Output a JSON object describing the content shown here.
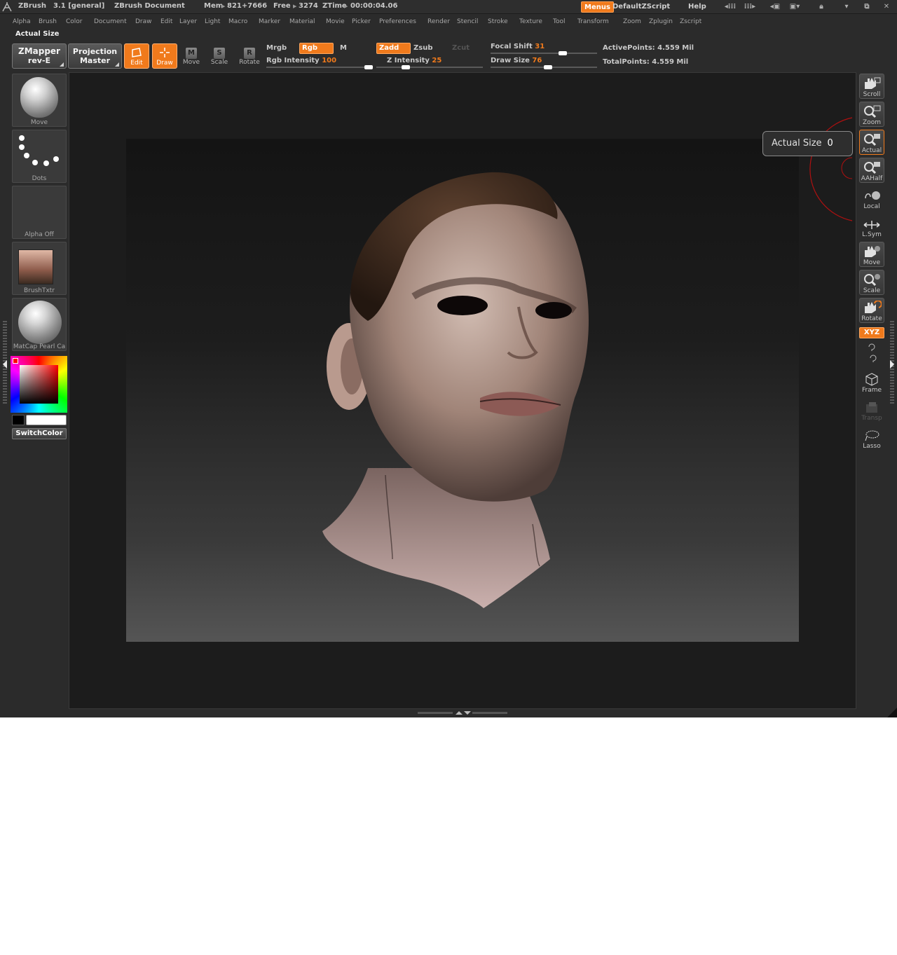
{
  "app": {
    "name": "ZBrush",
    "version": "3.1 [general]",
    "document": "ZBrush Document",
    "mem_label": "Mem",
    "mem_value": "821+7666",
    "free_label": "Free",
    "free_value": "3274",
    "ztime_label": "ZTime",
    "ztime_value": "00:00:04.06"
  },
  "titlebar_buttons": {
    "menus": "Menus",
    "script": "DefaultZScript",
    "help": "Help"
  },
  "menus": [
    "Alpha",
    "Brush",
    "Color",
    "Document",
    "Draw",
    "Edit",
    "Layer",
    "Light",
    "Macro",
    "Marker",
    "Material",
    "Movie",
    "Picker",
    "Preferences",
    "Render",
    "Stencil",
    "Stroke",
    "Texture",
    "Tool",
    "Transform",
    "Zoom",
    "Zplugin",
    "Zscript"
  ],
  "active_item_label": "Actual Size",
  "toolbar": {
    "zmapper_line1": "ZMapper",
    "zmapper_line2": "rev-E",
    "projection_line1": "Projection",
    "projection_line2": "Master",
    "edit": "Edit",
    "draw": "Draw",
    "move": "Move",
    "scale": "Scale",
    "rotate": "Rotate",
    "move_glyph": "M",
    "scale_glyph": "S",
    "rotate_glyph": "R",
    "mrgb": "Mrgb",
    "rgb": "Rgb",
    "m": "M",
    "rgb_intensity_label": "Rgb Intensity",
    "rgb_intensity_value": 100,
    "zadd": "Zadd",
    "zsub": "Zsub",
    "zcut": "Zcut",
    "z_intensity_label": "Z Intensity",
    "z_intensity_value": 25,
    "focal_shift_label": "Focal Shift",
    "focal_shift_value": 31,
    "draw_size_label": "Draw Size",
    "draw_size_value": 76,
    "active_points_label": "ActivePoints:",
    "active_points_value": "4.559 Mil",
    "total_points_label": "TotalPoints:",
    "total_points_value": "4.559 Mil"
  },
  "left_shelf": {
    "brush": "Move",
    "stroke": "Dots",
    "alpha": "Alpha Off",
    "texture": "BrushTxtr",
    "material": "MatCap Pearl Ca",
    "switch_color": "SwitchColor"
  },
  "right_shelf": {
    "scroll": "Scroll",
    "zoom": "Zoom",
    "actual": "Actual",
    "aahalf": "AAHalf",
    "local": "Local",
    "lsym": "L.Sym",
    "move": "Move",
    "scale": "Scale",
    "rotate": "Rotate",
    "xyz": "XYZ",
    "frame": "Frame",
    "transp": "Transp",
    "lasso": "Lasso"
  },
  "tooltip": {
    "label": "Actual Size",
    "value": "0"
  },
  "icons": {
    "zbrush_logo": "zbrush-logo-icon",
    "scroll": "hand-icon",
    "zoom": "magnifier-icon",
    "model": "sculpted-head-model"
  },
  "colors": {
    "accent": "#f07a1c",
    "panel": "#2b2b2b",
    "canvas": "#1c1c1c"
  }
}
